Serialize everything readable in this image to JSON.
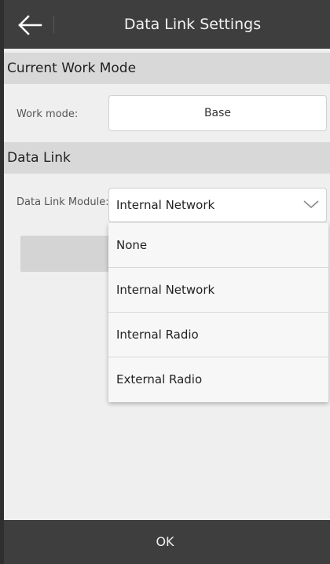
{
  "header": {
    "title": "Data Link Settings",
    "back_icon": "arrow-left-icon"
  },
  "work_mode_section": {
    "title": "Current Work Mode",
    "label": "Work mode:",
    "value": "Base"
  },
  "data_link_section": {
    "title": "Data Link",
    "module_label": "Data Link Module:",
    "module_selected": "Internal Network",
    "chevron_icon": "chevron-down-icon"
  },
  "dropdown": {
    "options": [
      "None",
      "Internal Network",
      "Internal Radio",
      "External Radio"
    ]
  },
  "footer": {
    "ok_label": "OK"
  },
  "colors": {
    "titlebar": "#3e3e3e",
    "section_header": "#d8d8d8",
    "background": "#efefef"
  }
}
